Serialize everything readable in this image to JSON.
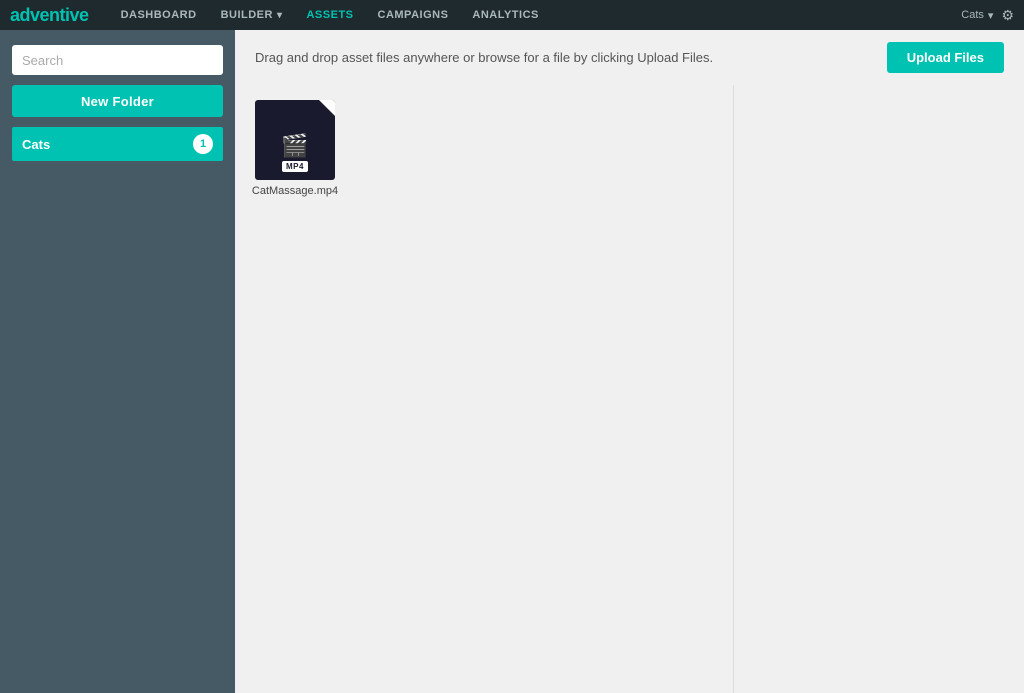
{
  "app": {
    "logo_prefix": "ad",
    "logo_suffix": "ventive"
  },
  "topnav": {
    "items": [
      {
        "label": "DASHBOARD",
        "active": false,
        "has_arrow": false
      },
      {
        "label": "BUILDER",
        "active": false,
        "has_arrow": true
      },
      {
        "label": "ASSETS",
        "active": true,
        "has_arrow": false
      },
      {
        "label": "CAMPAIGNS",
        "active": false,
        "has_arrow": false
      },
      {
        "label": "ANALYTICS",
        "active": false,
        "has_arrow": false
      }
    ],
    "user_label": "Cats",
    "settings_icon": "⚙"
  },
  "sidebar": {
    "search_placeholder": "Search",
    "new_folder_label": "New Folder",
    "folders": [
      {
        "name": "Cats",
        "count": 1
      }
    ]
  },
  "content": {
    "drop_hint": "Drag and drop asset files anywhere or browse for a file by clicking Upload Files.",
    "upload_label": "Upload Files",
    "files": [
      {
        "name": "CatMassage.mp4",
        "type": "MP4"
      }
    ]
  }
}
